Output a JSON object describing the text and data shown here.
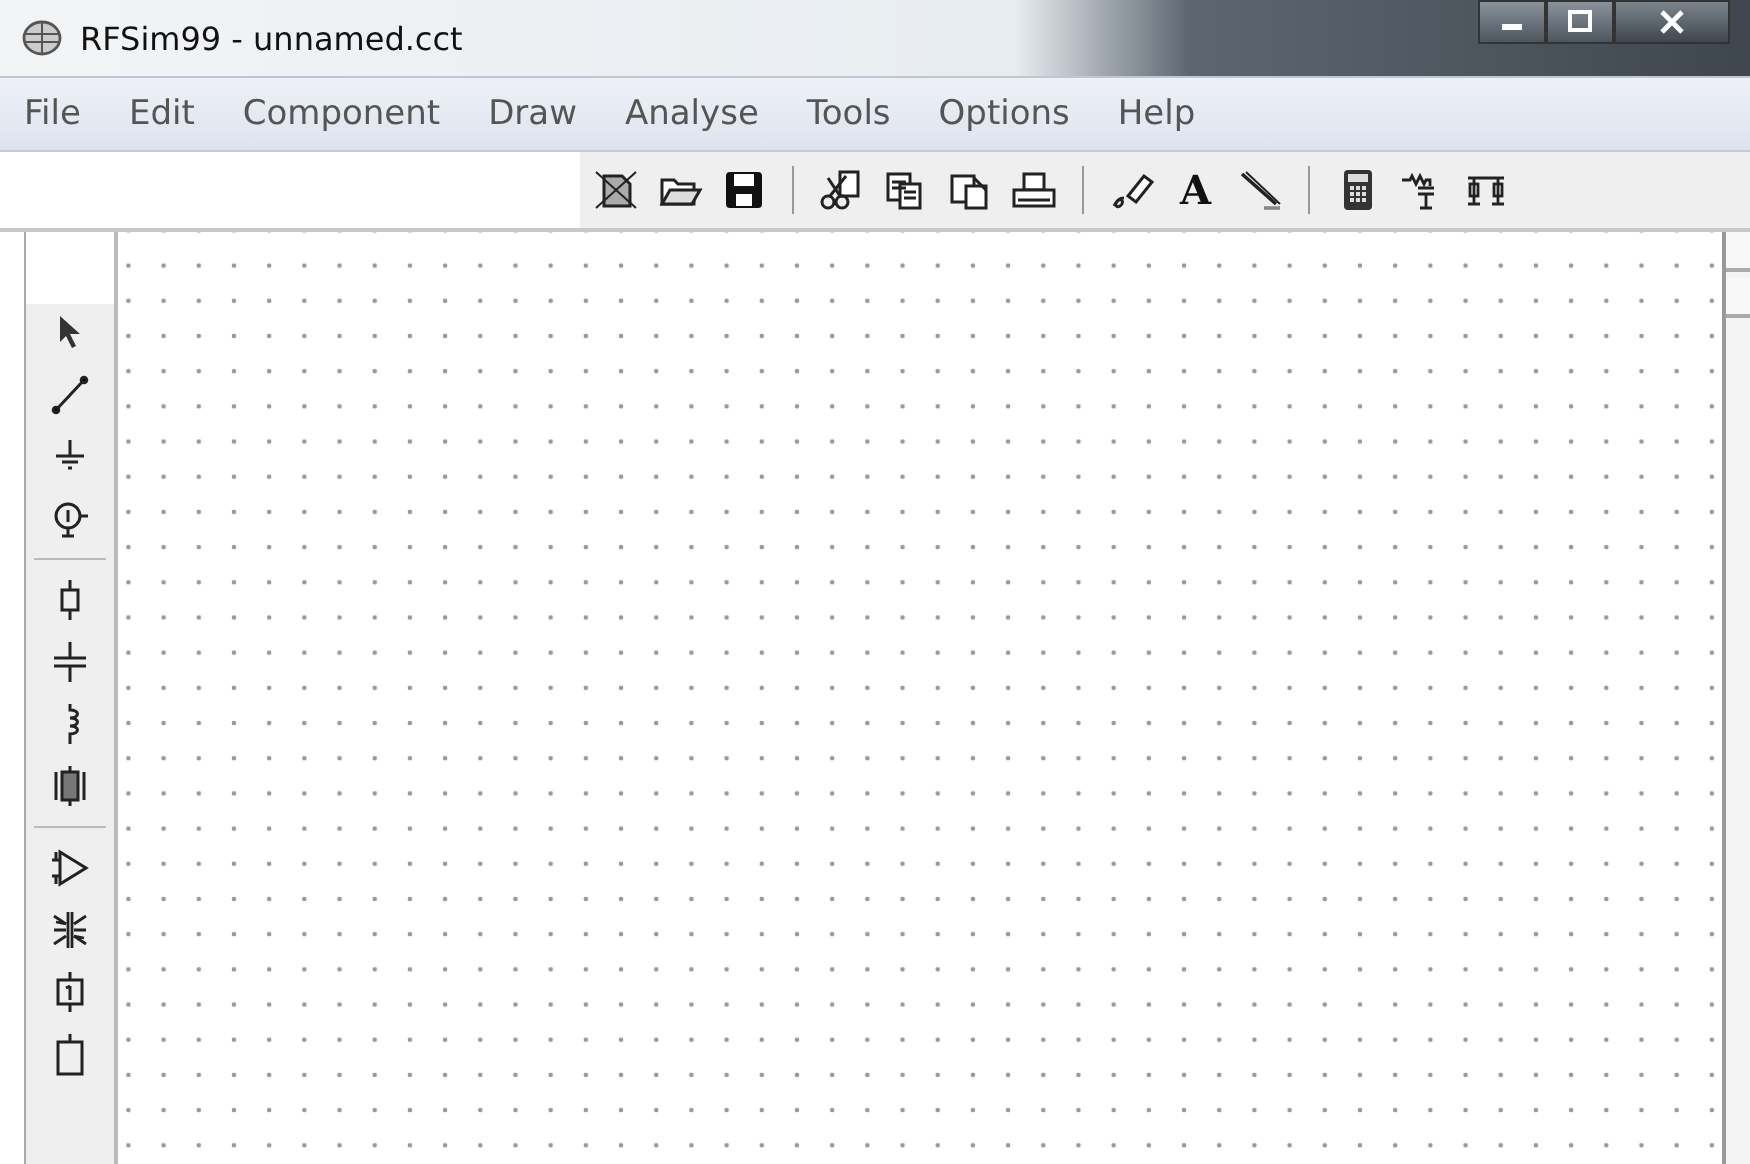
{
  "window": {
    "title": "RFSim99 - unnamed.cct"
  },
  "menu": [
    {
      "label": "File"
    },
    {
      "label": "Edit"
    },
    {
      "label": "Component"
    },
    {
      "label": "Draw"
    },
    {
      "label": "Analyse"
    },
    {
      "label": "Tools"
    },
    {
      "label": "Options"
    },
    {
      "label": "Help"
    }
  ],
  "toolbar": [
    [
      {
        "kind": "new"
      },
      {
        "kind": "open"
      },
      {
        "kind": "save"
      }
    ],
    [
      {
        "kind": "cut"
      },
      {
        "kind": "copy"
      },
      {
        "kind": "paste"
      },
      {
        "kind": "print"
      }
    ],
    [
      {
        "kind": "erase"
      },
      {
        "kind": "text",
        "glyph": "A"
      },
      {
        "kind": "pencil"
      }
    ],
    [
      {
        "kind": "calculator"
      },
      {
        "kind": "rlc"
      },
      {
        "kind": "network"
      }
    ]
  ],
  "palette": [
    [
      {
        "kind": "pointer"
      },
      {
        "kind": "wire"
      },
      {
        "kind": "ground"
      },
      {
        "kind": "source"
      }
    ],
    [
      {
        "kind": "resistor"
      },
      {
        "kind": "capacitor"
      },
      {
        "kind": "inductor"
      },
      {
        "kind": "crystal"
      }
    ],
    [
      {
        "kind": "amplifier"
      },
      {
        "kind": "transformer"
      },
      {
        "kind": "block"
      },
      {
        "kind": "block-partial"
      }
    ]
  ]
}
